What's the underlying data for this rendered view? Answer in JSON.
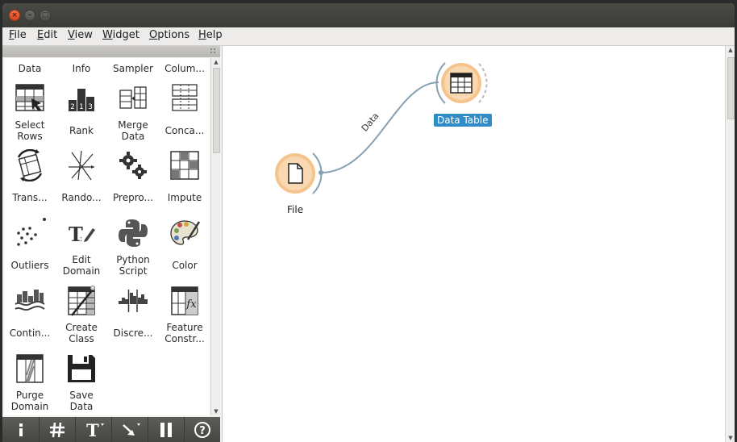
{
  "window": {
    "controls": [
      "close",
      "minimize",
      "maximize"
    ]
  },
  "menu": [
    {
      "label": "File",
      "underline": "F",
      "rest": "ile"
    },
    {
      "label": "Edit",
      "underline": "E",
      "rest": "dit"
    },
    {
      "label": "View",
      "underline": "V",
      "rest": "iew"
    },
    {
      "label": "Widget",
      "underline": "W",
      "rest": "idget"
    },
    {
      "label": "Options",
      "underline": "O",
      "rest": "ptions"
    },
    {
      "label": "Help",
      "underline": "H",
      "rest": "elp"
    }
  ],
  "palette": {
    "top_row": [
      "Data",
      "Info",
      "Sampler",
      "Colum..."
    ],
    "widgets": [
      {
        "line1": "Select",
        "line2": "Rows",
        "icon": "select-rows-icon"
      },
      {
        "line1": "Rank",
        "line2": "",
        "icon": "rank-icon"
      },
      {
        "line1": "Merge",
        "line2": "Data",
        "icon": "merge-data-icon"
      },
      {
        "line1": "Conca...",
        "line2": "",
        "icon": "concatenate-icon"
      },
      {
        "line1": "Trans...",
        "line2": "",
        "icon": "transpose-icon"
      },
      {
        "line1": "Rando...",
        "line2": "",
        "icon": "randomize-icon"
      },
      {
        "line1": "Prepro...",
        "line2": "",
        "icon": "preprocess-icon"
      },
      {
        "line1": "Impute",
        "line2": "",
        "icon": "impute-icon"
      },
      {
        "line1": "Outliers",
        "line2": "",
        "icon": "outliers-icon"
      },
      {
        "line1": "Edit",
        "line2": "Domain",
        "icon": "edit-domain-icon"
      },
      {
        "line1": "Python",
        "line2": "Script",
        "icon": "python-script-icon"
      },
      {
        "line1": "Color",
        "line2": "",
        "icon": "color-icon"
      },
      {
        "line1": "Contin...",
        "line2": "",
        "icon": "continuize-icon"
      },
      {
        "line1": "Create",
        "line2": "Class",
        "icon": "create-class-icon"
      },
      {
        "line1": "Discre...",
        "line2": "",
        "icon": "discretize-icon"
      },
      {
        "line1": "Feature",
        "line2": "Constr...",
        "icon": "feature-constructor-icon"
      },
      {
        "line1": "Purge",
        "line2": "Domain",
        "icon": "purge-domain-icon"
      },
      {
        "line1": "Save",
        "line2": "Data",
        "icon": "save-data-icon"
      }
    ]
  },
  "bottom_toolbar": [
    "info-icon",
    "grid-icon",
    "text-annotation-icon",
    "arrow-annotation-icon",
    "pause-icon",
    "help-icon"
  ],
  "canvas": {
    "nodes": [
      {
        "label": "File",
        "icon": "file-icon",
        "selected": false
      },
      {
        "label": "Data Table",
        "icon": "table-icon",
        "selected": true
      }
    ],
    "link_label": "Data"
  },
  "colors": {
    "node_fill": "#f9d9b2",
    "node_ring": "#f5c48c",
    "link": "#87a1b2",
    "selection": "#308cc6"
  }
}
